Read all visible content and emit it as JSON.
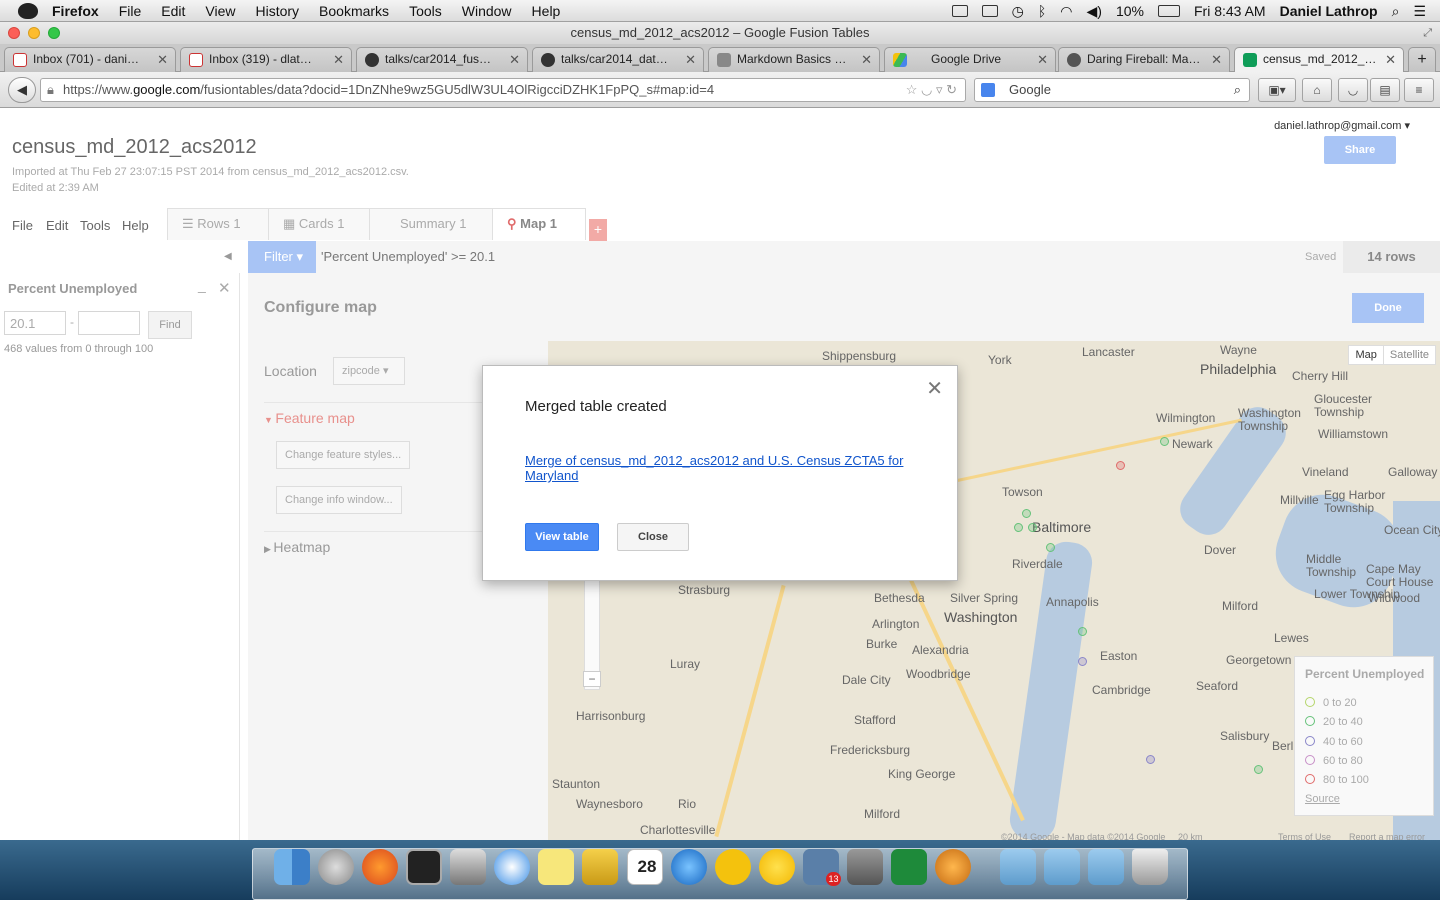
{
  "menubar": {
    "app": "Firefox",
    "items": [
      "File",
      "Edit",
      "View",
      "History",
      "Bookmarks",
      "Tools",
      "Window",
      "Help"
    ],
    "battery": "10%",
    "clock": "Fri 8:43 AM",
    "user": "Daniel Lathrop"
  },
  "window": {
    "title": "census_md_2012_acs2012 – Google Fusion Tables"
  },
  "tabs": [
    {
      "label": "Inbox (701) - dani…",
      "icon": "gmail-icon"
    },
    {
      "label": "Inbox (319) - dlat…",
      "icon": "gmail-icon"
    },
    {
      "label": "talks/car2014_fus…",
      "icon": "github-icon"
    },
    {
      "label": "talks/car2014_dat…",
      "icon": "github-icon"
    },
    {
      "label": "Markdown Basics …",
      "icon": "markdown-icon"
    },
    {
      "label": "Google Drive",
      "icon": "drive-icon"
    },
    {
      "label": "Daring Fireball: Ma…",
      "icon": "star-icon"
    },
    {
      "label": "census_md_2012_…",
      "icon": "fusion-tables-icon"
    }
  ],
  "nav": {
    "url_prefix": "https://www.",
    "url_host": "google.com",
    "url_rest": "/fusiontables/data?docid=1DnZNhe9wz5GU5dlW3UL4OlRigcciDZHK1FpPQ_s#map:id=4",
    "search_engine": "Google"
  },
  "doc": {
    "title": "census_md_2012_acs2012",
    "imported": "Imported at Thu Feb 27 23:07:15 PST 2014 from census_md_2012_acs2012.csv.",
    "edited": "Edited at 2:39 AM",
    "account": "daniel.lathrop@gmail.com",
    "share": "Share"
  },
  "appmenu": [
    "File",
    "Edit",
    "Tools",
    "Help"
  ],
  "views": [
    {
      "label": "Rows 1"
    },
    {
      "label": "Cards 1"
    },
    {
      "label": "Summary 1"
    },
    {
      "label": "Map 1"
    }
  ],
  "filterbar": {
    "button": "Filter",
    "expression": "'Percent Unemployed' >= 20.1",
    "status": "Saved",
    "row_count": "14 rows"
  },
  "filter_panel": {
    "field": "Percent Unemployed",
    "min_value": "20.1",
    "max_value": "",
    "separator": "-",
    "find": "Find",
    "note": "468 values from 0 through 100"
  },
  "configure": {
    "title": "Configure map",
    "done": "Done",
    "location_label": "Location",
    "location_value": "zipcode",
    "feature_map": "Feature map",
    "change_styles": "Change feature styles...",
    "change_info": "Change info window...",
    "heatmap": "Heatmap"
  },
  "map": {
    "type_map": "Map",
    "type_satellite": "Satellite",
    "towns": [
      "Shippensburg",
      "York",
      "Lancaster",
      "Wayne",
      "Philadelphia",
      "Cherry Hill",
      "Wilmington",
      "Washington Township",
      "Gloucester Township",
      "Williamstown",
      "Newark",
      "Vineland",
      "Galloway",
      "Towson",
      "Baltimore",
      "Millville",
      "Egg Harbor Township",
      "Riverdale",
      "Dover",
      "Ocean City",
      "Middle Township",
      "Cape May Court House",
      "Lower Township",
      "Wildwood",
      "Strasburg",
      "Bethesda",
      "Silver Spring",
      "Annapolis",
      "Milford",
      "Arlington",
      "Washington",
      "Burke",
      "Alexandria",
      "Lewes",
      "Luray",
      "Dale City",
      "Woodbridge",
      "Easton",
      "Georgetown",
      "Cambridge",
      "Seaford",
      "Harrisonburg",
      "Stafford",
      "Fredericksburg",
      "Salisbury",
      "Berlin",
      "King George",
      "Staunton",
      "Waynesboro",
      "Rio",
      "Milford",
      "Charlottesville"
    ],
    "attribution": "©2014 Google - Map data ©2014 Google",
    "scale": "20 km",
    "terms": "Terms of Use",
    "report": "Report a map error"
  },
  "legend": {
    "title": "Percent Unemployed",
    "items": [
      {
        "label": "0 to 20",
        "color": "#b5d66b"
      },
      {
        "label": "20 to 40",
        "color": "#66c27a"
      },
      {
        "label": "40 to 60",
        "color": "#8a86c9"
      },
      {
        "label": "60 to 80",
        "color": "#c890c8"
      },
      {
        "label": "80 to 100",
        "color": "#e06b6b"
      }
    ],
    "source": "Source"
  },
  "dialog": {
    "title": "Merged table created",
    "link": "Merge of census_md_2012_acs2012 and U.S. Census ZCTA5 for Maryland",
    "view": "View table",
    "close": "Close"
  },
  "dock": {
    "calendar_month": "FEB",
    "calendar_day": "28",
    "badge": "13"
  }
}
